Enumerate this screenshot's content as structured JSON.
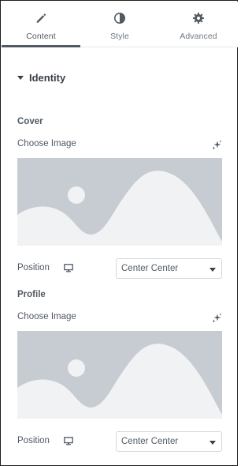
{
  "tabs": [
    {
      "label": "Content",
      "icon": "pencil-icon",
      "active": true
    },
    {
      "label": "Style",
      "icon": "contrast-icon",
      "active": false
    },
    {
      "label": "Advanced",
      "icon": "gear-icon",
      "active": false
    }
  ],
  "section": {
    "title": "Identity",
    "icon": "caret-down-icon"
  },
  "cover": {
    "heading": "Cover",
    "choose_label": "Choose Image",
    "ai_icon": "sparkle-icon",
    "position_label": "Position",
    "device_icon": "desktop-icon",
    "position_value": "Center Center"
  },
  "profile": {
    "heading": "Profile",
    "choose_label": "Choose Image",
    "ai_icon": "sparkle-icon",
    "position_label": "Position",
    "device_icon": "desktop-icon",
    "position_value": "Center Center"
  },
  "colors": {
    "text": "#515962",
    "placeholder_bg": "#c6ccd2",
    "placeholder_fg": "#f1f2f3",
    "frame_border": "#1f1f1f"
  }
}
